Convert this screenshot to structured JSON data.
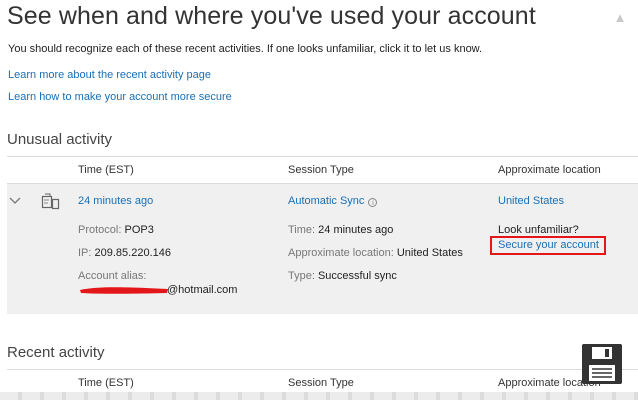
{
  "page": {
    "title": "See when and where you've used your account",
    "intro": "You should recognize each of these recent activities. If one looks unfamiliar, click it to let us know.",
    "links": [
      "Learn more about the recent activity page",
      "Learn how to make your account more secure"
    ]
  },
  "unusual": {
    "heading": "Unusual activity",
    "columns": {
      "time": "Time (EST)",
      "session": "Session Type",
      "location": "Approximate location"
    },
    "activity": {
      "time": "24 minutes ago",
      "session_type": "Automatic Sync",
      "location": "United States",
      "details": {
        "protocol_label": "Protocol:",
        "protocol_value": "POP3",
        "ip_label": "IP:",
        "ip_value": "209.85.220.146",
        "alias_label": "Account alias:",
        "alias_domain": "@hotmail.com",
        "time_label": "Time:",
        "time_value": "24 minutes ago",
        "location_label": "Approximate location:",
        "location_value": "United States",
        "type_label": "Type:",
        "type_value": "Successful sync",
        "look_unfamiliar": "Look unfamiliar?",
        "secure_link": "Secure your account"
      }
    }
  },
  "recent": {
    "heading": "Recent activity",
    "columns": {
      "time": "Time (EST)",
      "session": "Session Type",
      "location": "Approximate location"
    }
  },
  "colors": {
    "link": "#1a6fb5",
    "highlight": "#e3161a",
    "redaction": "#e3161a",
    "panel": "#f0f0f0"
  },
  "icons": {
    "chevron": "chevron-down-icon",
    "device": "sync-device-icon",
    "info": "info-icon",
    "save": "floppy-save-icon"
  }
}
